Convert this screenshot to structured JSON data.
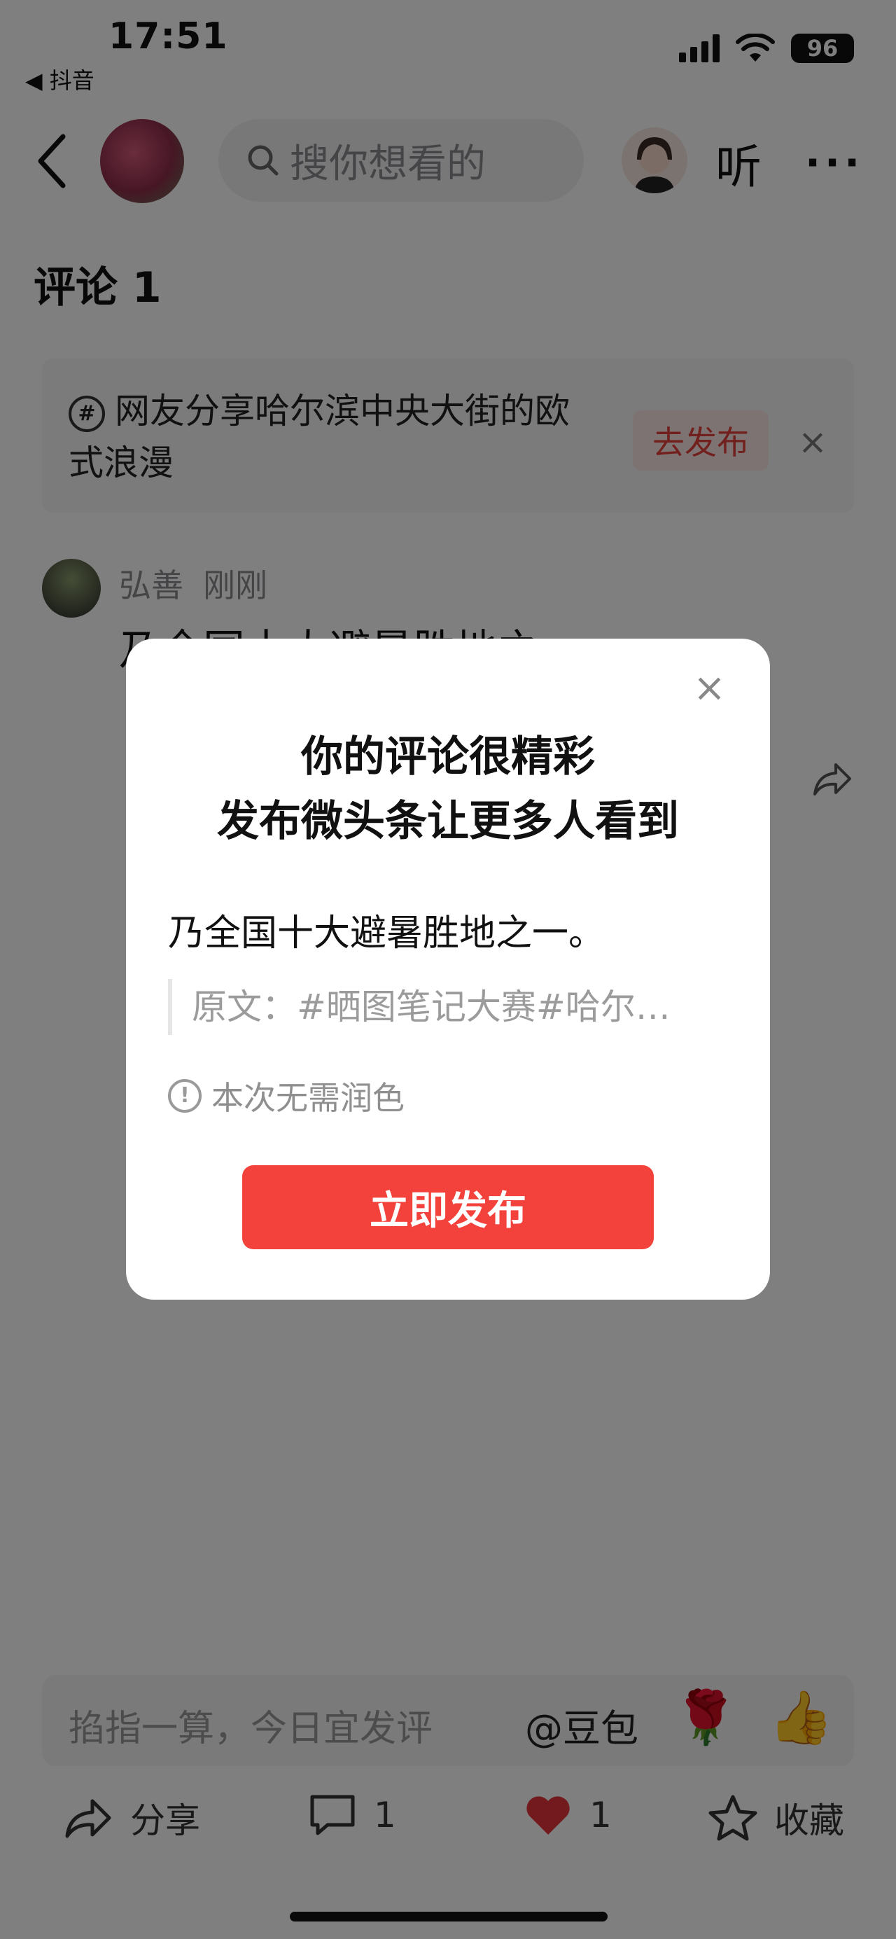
{
  "status_bar": {
    "time": "17:51",
    "back_app": "◀ 抖音",
    "battery": "96"
  },
  "header": {
    "search_placeholder": "搜你想看的",
    "listen_label": "听",
    "more_label": "···"
  },
  "comments": {
    "title": "评论 1",
    "banner": {
      "text": "网友分享哈尔滨中央大街的欧式浪漫",
      "publish_label": "去发布",
      "close_label": "×"
    },
    "item": {
      "user": "弘善",
      "time": "刚刚",
      "text": "乃全国十大避暑胜地之"
    }
  },
  "input_bar": {
    "placeholder": "掐指一算，今日宜发评",
    "doubao_label": "@豆包",
    "rose_emoji": "🌹",
    "thumb_emoji": "👍"
  },
  "actions": {
    "share": "分享",
    "comments_count": "1",
    "likes_count": "1",
    "favorite": "收藏"
  },
  "modal": {
    "title_line1": "你的评论很精彩",
    "title_line2": "发布微头条让更多人看到",
    "comment_text": "乃全国十大避暑胜地之一。",
    "quote_text": "原文：#晒图笔记大赛#哈尔…",
    "info_text": "本次无需润色",
    "publish_button": "立即发布",
    "close_label": "×"
  },
  "colors": {
    "accent": "#f3423b",
    "like": "#e5343a"
  }
}
